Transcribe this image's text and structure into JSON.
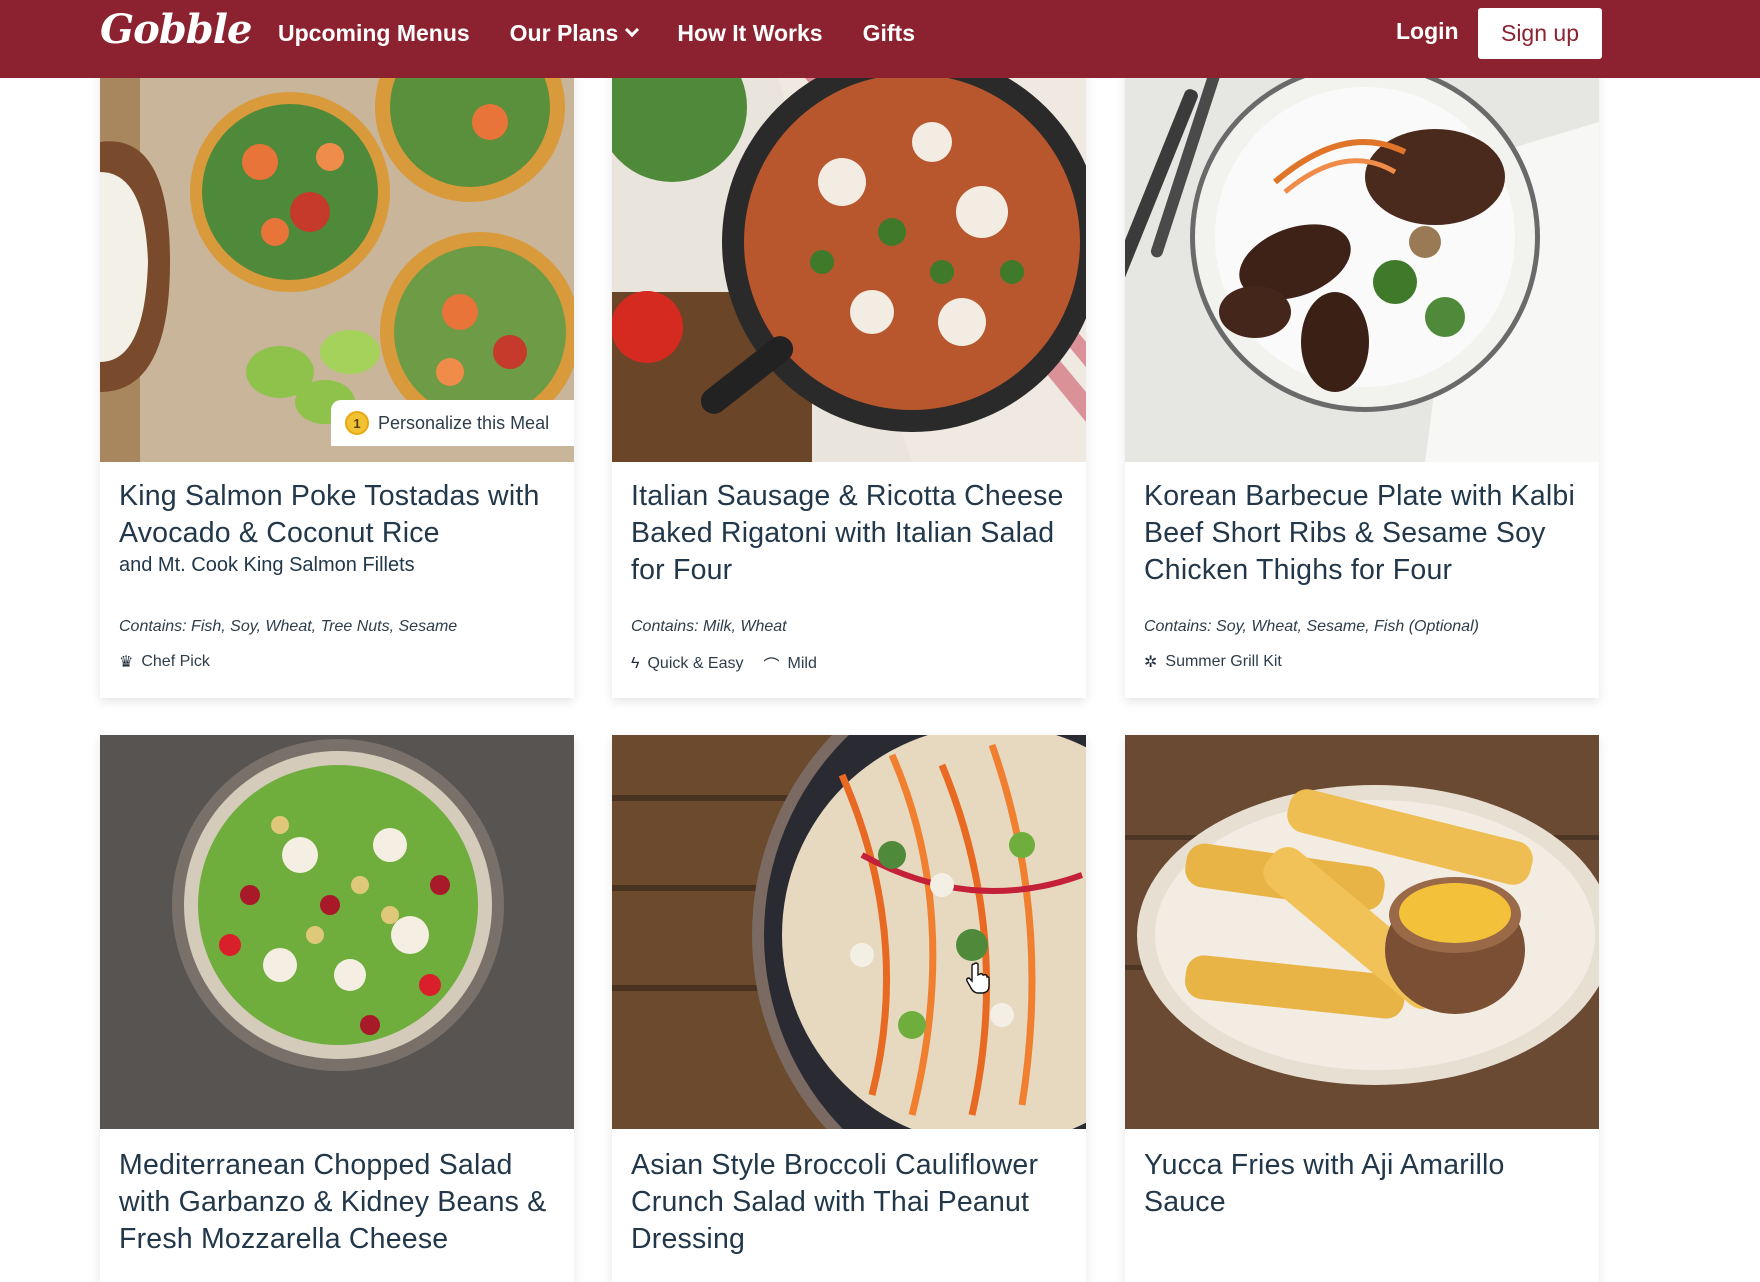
{
  "header": {
    "logo": "Gobble",
    "nav": [
      {
        "label": "Upcoming Menus"
      },
      {
        "label": "Our Plans"
      },
      {
        "label": "How It Works"
      },
      {
        "label": "Gifts"
      }
    ],
    "login": "Login",
    "signup": "Sign up",
    "brand_color": "#8c2230"
  },
  "meals": [
    {
      "title": "King Salmon Poke Tostadas with Avocado & Coconut Rice",
      "subtitle": "and Mt. Cook King Salmon Fillets",
      "allergens": "Contains: Fish, Soy, Wheat, Tree Nuts, Sesame",
      "tags": [
        {
          "icon": "chef-hat-icon",
          "label": "Chef Pick"
        }
      ],
      "personalize": {
        "badge": "1",
        "label": "Personalize this Meal"
      }
    },
    {
      "title": "Italian Sausage & Ricotta Cheese Baked Rigatoni with Italian Salad for Four",
      "allergens": "Contains: Milk, Wheat",
      "tags": [
        {
          "icon": "lightning-icon",
          "label": "Quick & Easy"
        },
        {
          "icon": "pepper-icon",
          "label": "Mild"
        }
      ]
    },
    {
      "title": "Korean Barbecue Plate with Kalbi Beef Short Ribs & Sesame Soy Chicken Thighs for Four",
      "allergens": "Contains: Soy, Wheat, Sesame, Fish (Optional)",
      "tags": [
        {
          "icon": "sun-icon",
          "label": "Summer Grill Kit"
        }
      ]
    },
    {
      "title": "Mediterranean Chopped Salad with Garbanzo & Kidney Beans & Fresh Mozzarella Cheese"
    },
    {
      "title": "Asian Style Broccoli Cauliflower Crunch Salad with Thai Peanut Dressing"
    },
    {
      "title": "Yucca Fries with Aji Amarillo Sauce"
    }
  ]
}
